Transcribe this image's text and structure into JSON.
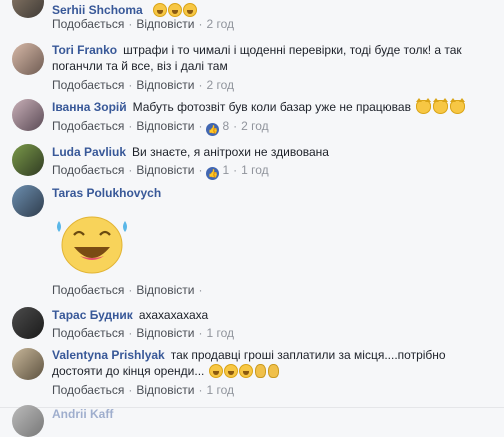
{
  "labels": {
    "like": "Подобається",
    "reply": "Відповісти",
    "dot": "·"
  },
  "comments": [
    {
      "name": "Serhii Shchoma",
      "text": "",
      "time": "2 год"
    },
    {
      "name": "Tori Franko",
      "text": "штрафи і то чималі і щоденні перевірки, тоді буде толк! а так поганчли та й все, віз і далі там",
      "time": "2 год"
    },
    {
      "name": "Іванна Зорій",
      "text": "Мабуть фотозвіт був коли базар уже не працював",
      "likes": "8",
      "time": "2 год"
    },
    {
      "name": "Luda Pavliuk",
      "text": "Ви знаєте, я анітрохи не здивована",
      "likes": "1",
      "time": "1 год"
    },
    {
      "name": "Taras Polukhovych",
      "text": ""
    },
    {
      "name": "Тарас Будник",
      "text": "ахахахахаха",
      "time": "1 год"
    },
    {
      "name": "Valentyna Prishlyak",
      "text": "так продавці гроші заплатили за місця....потрібно достояти до кінця оренди...",
      "time": "1 год"
    },
    {
      "name": "Andrii Kaff",
      "text": ""
    }
  ]
}
